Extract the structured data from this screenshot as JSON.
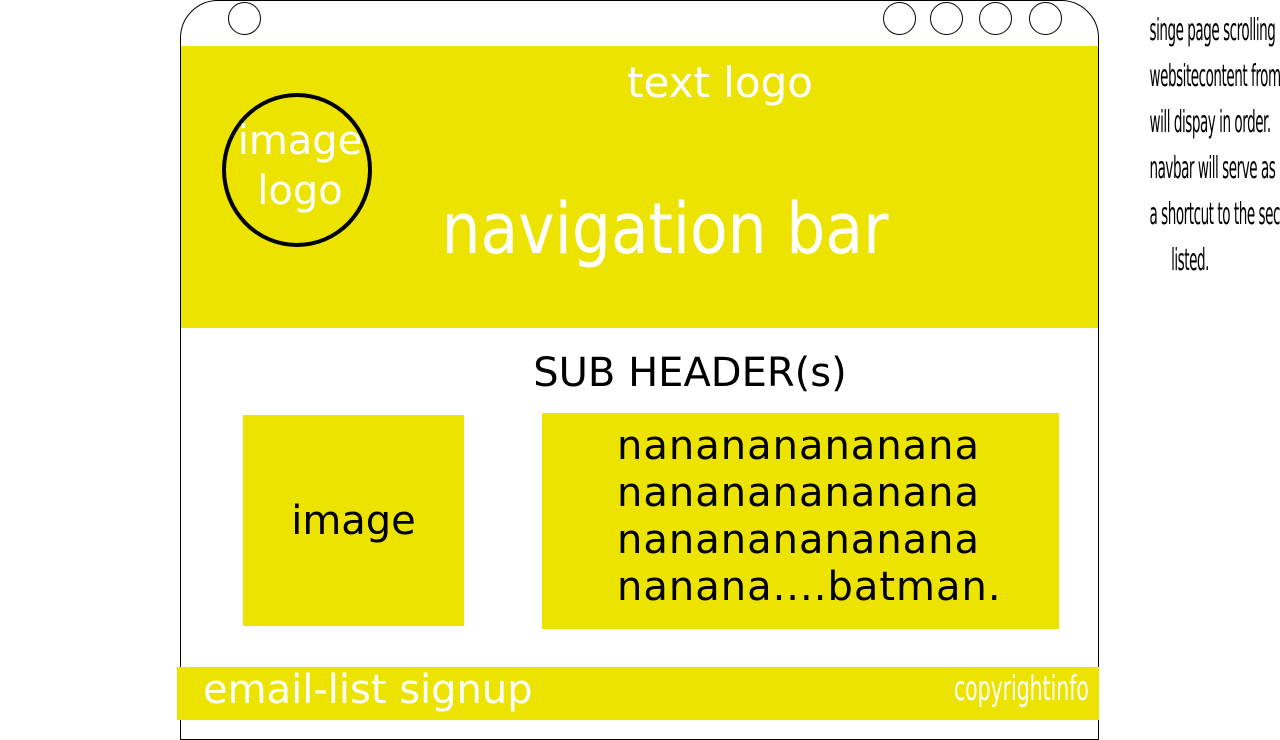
{
  "window": {
    "buttons": [
      "left-button",
      "button-1",
      "button-2",
      "button-3",
      "button-4"
    ]
  },
  "navbar": {
    "text_logo": "text logo",
    "image_logo_lines": [
      "image",
      "logo"
    ],
    "title": "navigation bar"
  },
  "main": {
    "sub_header": "SUB HEADER(s)",
    "image_label": "image",
    "text_lines": [
      "nanananananana",
      "nanananananana",
      "nanananananana",
      "nanana....batman."
    ]
  },
  "footer": {
    "signup": "email-list signup",
    "copyright": "copyrightinfo"
  },
  "note": {
    "lines": [
      "singe page scrolling",
      "websitecontent from navbar",
      "will dispay in order.",
      "navbar will serve as",
      "a shortcut to the sections",
      "listed."
    ]
  },
  "colors": {
    "accent": "#ede300",
    "text_on_accent": "#ffffff",
    "outline": "#000000"
  }
}
